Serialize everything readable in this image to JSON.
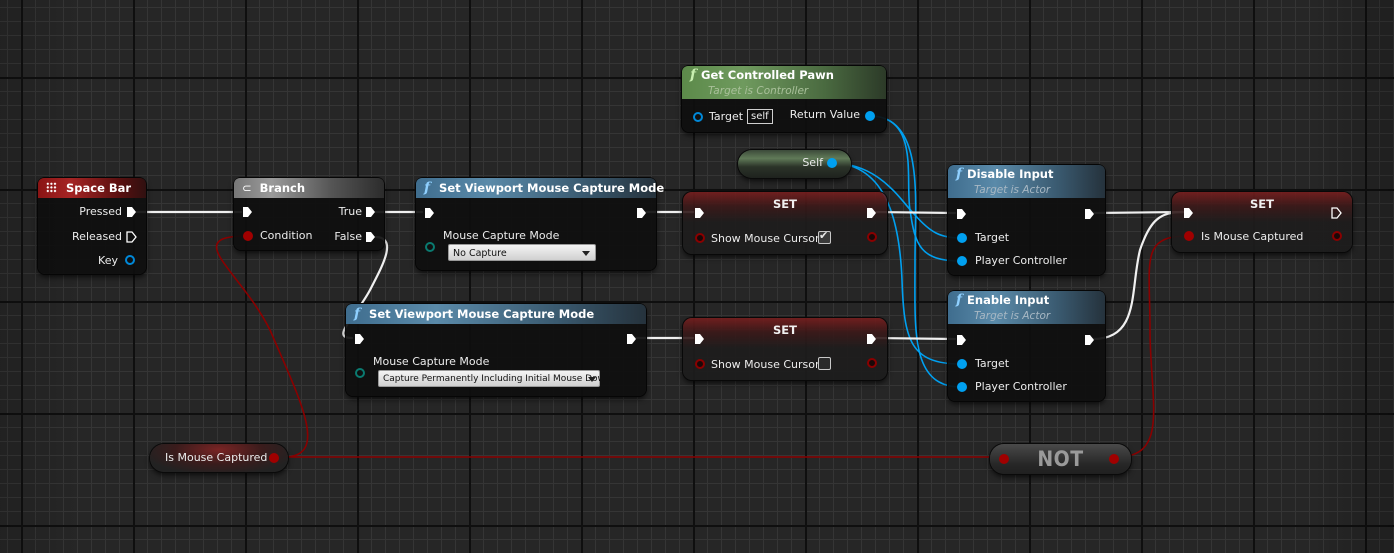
{
  "graph": {
    "type": "blueprint-event-graph",
    "colors": {
      "background": "#262626",
      "exec_wire": "#ffffff",
      "object_wire": "#00a0f0",
      "bool_wire": "#8a0000",
      "enum_pin": "#0a7a70"
    }
  },
  "nodes": {
    "space_bar": {
      "title": "Space Bar",
      "icon": "keyboard-icon",
      "pins": {
        "pressed": "Pressed",
        "released": "Released",
        "key": "Key"
      }
    },
    "branch": {
      "title": "Branch",
      "icon": "branch-icon",
      "pins": {
        "condition": "Condition",
        "true": "True",
        "false": "False"
      }
    },
    "set_capture_top": {
      "title": "Set Viewport Mouse Capture Mode",
      "icon": "function-icon",
      "param_label": "Mouse Capture Mode",
      "selected_option": "No Capture"
    },
    "set_capture_bottom": {
      "title": "Set Viewport Mouse Capture Mode",
      "icon": "function-icon",
      "param_label": "Mouse Capture Mode",
      "selected_option": "Capture Permanently Including Initial Mouse Down"
    },
    "get_controlled_pawn": {
      "title": "Get Controlled Pawn",
      "subtitle": "Target is Controller",
      "icon": "function-icon",
      "target_label": "Target",
      "target_default": "self",
      "return_label": "Return Value"
    },
    "self_ref": {
      "label": "Self"
    },
    "set_cursor_top": {
      "title": "SET",
      "var_label": "Show Mouse Cursor",
      "checked": true
    },
    "set_cursor_bottom": {
      "title": "SET",
      "var_label": "Show Mouse Cursor",
      "checked": false
    },
    "disable_input": {
      "title": "Disable Input",
      "subtitle": "Target is Actor",
      "icon": "function-icon",
      "pins": {
        "target": "Target",
        "player_controller": "Player Controller"
      }
    },
    "enable_input": {
      "title": "Enable Input",
      "subtitle": "Target is Actor",
      "icon": "function-icon",
      "pins": {
        "target": "Target",
        "player_controller": "Player Controller"
      }
    },
    "set_captured": {
      "title": "SET",
      "var_label": "Is Mouse Captured"
    },
    "get_captured": {
      "label": "Is Mouse Captured"
    },
    "not_node": {
      "label": "NOT"
    }
  },
  "glyphs": {
    "function": "f",
    "checkmark": "✔"
  }
}
